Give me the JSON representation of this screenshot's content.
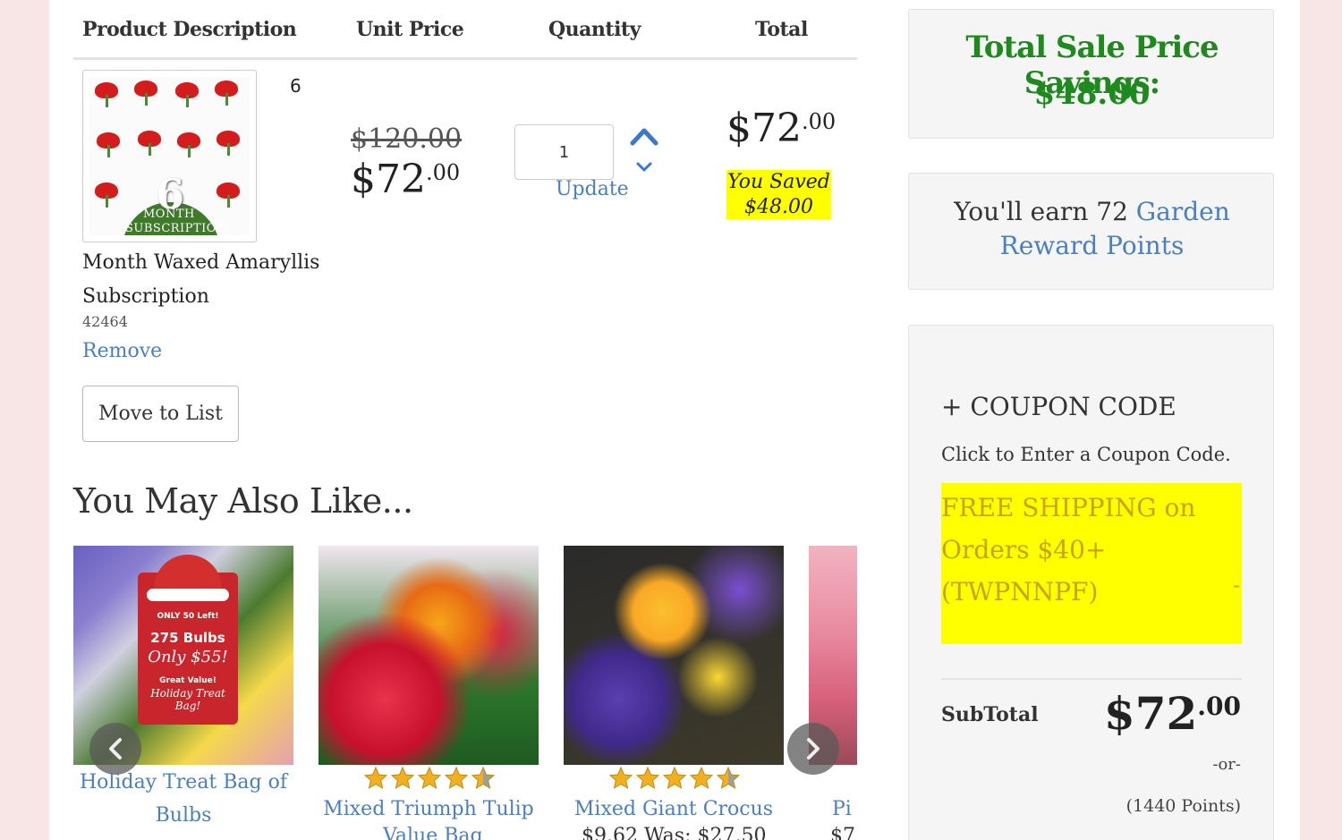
{
  "table": {
    "headers": [
      "Product Description",
      "Unit Price",
      "Quantity",
      "Total"
    ]
  },
  "item": {
    "thumb": {
      "number": "6",
      "line1": "MONTH",
      "line2": "SUBSCRIPTION"
    },
    "count": "6",
    "name": "Month Waxed Amaryllis Subscription",
    "sku": "42464",
    "remove_label": "Remove",
    "move_label": "Move to List",
    "was_price": "$120.00",
    "unit_price_main": "$72",
    "unit_price_cents": ".00",
    "quantity": "1",
    "update_label": "Update",
    "total_main": "$72",
    "total_cents": ".00",
    "saved_line1": "You Saved",
    "saved_line2": "$48.00"
  },
  "recommendations": {
    "heading": "You May Also Like...",
    "cards": [
      {
        "title": "Holiday Treat Bag of Bulbs",
        "bag": {
          "l1": "ONLY 50 Left!",
          "l2": "275 Bulbs",
          "l3": "Only $55!",
          "l4": "Great Value!",
          "l5": "Holiday Treat Bag!"
        },
        "rating": 0
      },
      {
        "title": "Mixed Triumph Tulip",
        "line2": "Value Bag",
        "rating": 4.5
      },
      {
        "title": "Mixed Giant Crocus",
        "line2": "$9.62  Was: $27.50",
        "rating": 4.5
      },
      {
        "title": "Pi",
        "line2": "$7"
      }
    ]
  },
  "sidebar": {
    "savings_title": "Total Sale Price Savings:",
    "savings_amount": "$48.00",
    "earn_prefix": "You'll earn 72",
    "earn_link": "Garden Reward Points",
    "coupon_heading": "+ COUPON CODE",
    "coupon_sub": "Click to Enter a Coupon Code.",
    "promo_text": "FREE SHIPPING on Orders $40+ (TWPNNPF)",
    "promo_dash": "-",
    "subtotal_label": "SubTotal",
    "subtotal_main": "$72",
    "subtotal_cents": ".00",
    "or_label": "-or-",
    "points_label": "(1440 Points)"
  },
  "colors": {
    "link": "#4a7fc1",
    "savings_green": "#1e8a1e",
    "highlight": "#ffff00",
    "background_pink": "#f8e6e6"
  }
}
